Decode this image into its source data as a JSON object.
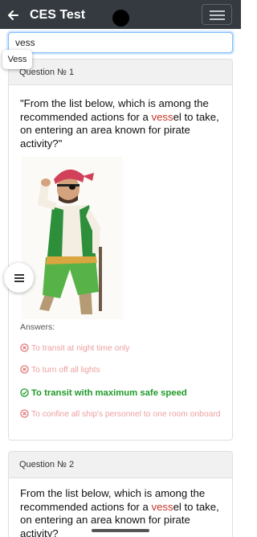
{
  "appbar": {
    "title": "CES Test",
    "back_icon": "arrow-left-icon",
    "menu_icon": "hamburger-icon",
    "background": "#343a40"
  },
  "search": {
    "value": "vess",
    "suggestion": "Vess"
  },
  "questions": [
    {
      "header": "Question № 1",
      "text_before": "\"From the list below, which is among the recommended actions for a ",
      "highlight": "vess",
      "text_after": "el to take, on entering an area known for pirate activity?\"",
      "image_icon": "pirate-illustration",
      "answers_label": "Answers:",
      "answers": [
        {
          "text": "To transit at night time only",
          "correct": false,
          "icon": "x-circle-icon"
        },
        {
          "text": "To turn off all lights",
          "correct": false,
          "icon": "x-circle-icon"
        },
        {
          "text": "To transit with maximum safe speed",
          "correct": true,
          "icon": "check-circle-icon"
        },
        {
          "text": "To confine all ship's personnel to one room onboard",
          "correct": false,
          "icon": "x-circle-icon"
        }
      ]
    },
    {
      "header": "Question № 2",
      "text_before": "From the list below, which is among the recommended actions for a ",
      "highlight": "vess",
      "text_after": "el to take, on entering an area known for pirate activity?"
    }
  ],
  "fab_icon": "list-icon",
  "colors": {
    "highlight": "#c0392b",
    "correct": "#1e9a27",
    "wrong": "#ec9f9f",
    "focus_border": "#80bdff"
  }
}
